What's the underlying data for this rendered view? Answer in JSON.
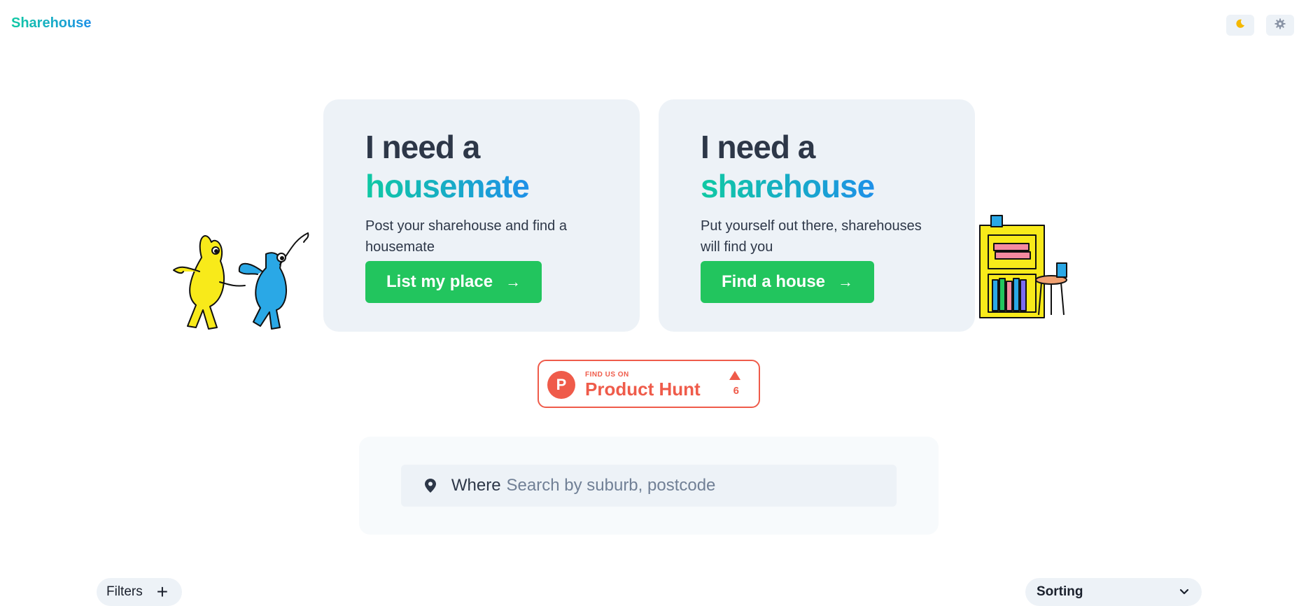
{
  "header": {
    "brand": "Sharehouse",
    "theme_toggle_icon": "moon-icon",
    "settings_icon": "gear-icon"
  },
  "cards": [
    {
      "title_line1": "I need a",
      "title_line2": "housemate",
      "description": "Post your sharehouse and find a housemate",
      "button_label": "List my place"
    },
    {
      "title_line1": "I need a",
      "title_line2": "sharehouse",
      "description": "Put yourself out there, sharehouses will find you",
      "button_label": "Find a house"
    }
  ],
  "product_hunt": {
    "small_text": "FIND US ON",
    "big_text": "Product Hunt",
    "logo_letter": "P",
    "upvotes": "6"
  },
  "search": {
    "label": "Where",
    "placeholder": "Search by suburb, postcode",
    "value": ""
  },
  "toolbar": {
    "filters_label": "Filters",
    "sorting_label": "Sorting"
  },
  "colors": {
    "accent_green": "#22c55e",
    "gradient_start": "#10c9a3",
    "gradient_end": "#1e90e8",
    "product_hunt": "#ef5b4a",
    "card_bg": "#edf2f7"
  }
}
